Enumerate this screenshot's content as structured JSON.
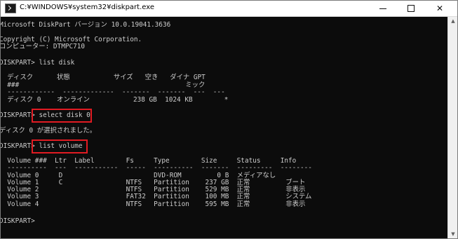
{
  "window": {
    "title": "C:¥WINDOWS¥system32¥diskpart.exe",
    "controls": {
      "minimize": "–",
      "maximize": "☐",
      "close": "✕"
    }
  },
  "console": {
    "lines": [
      "Microsoft DiskPart バージョン 10.0.19041.3636",
      "",
      "Copyright (C) Microsoft Corporation.",
      "コンピューター: DTMPC710",
      "",
      "DISKPART> list disk",
      "",
      "  ディスク      状態           サイズ   空き   ダイナ GPT",
      "  ###                                          ミック",
      "  ------------  -------------  -------  -------  ---  ---",
      "  ディスク 0    オンライン           238 GB  1024 KB        *",
      "",
      "DISKPART> select disk 0",
      "",
      "ディスク 0 が選択されました。",
      "",
      "DISKPART> list volume",
      "",
      "  Volume ###  Ltr  Label        Fs     Type        Size     Status     Info",
      "  ----------  ---  -----------  -----  ----------  -------  ---------  --------",
      "  Volume 0     D                       DVD-ROM         0 B  メディアなし",
      "  Volume 1     C                NTFS   Partition    237 GB  正常         ブート",
      "  Volume 2                      NTFS   Partition    529 MB  正常         非表示",
      "  Volume 3                      FAT32  Partition    100 MB  正常         システム",
      "  Volume 4                      NTFS   Partition    595 MB  正常         非表示",
      "",
      "DISKPART>"
    ]
  },
  "colors": {
    "console_bg": "#0c0c0c",
    "console_text": "#cccccc",
    "highlight": "#e11b22"
  }
}
